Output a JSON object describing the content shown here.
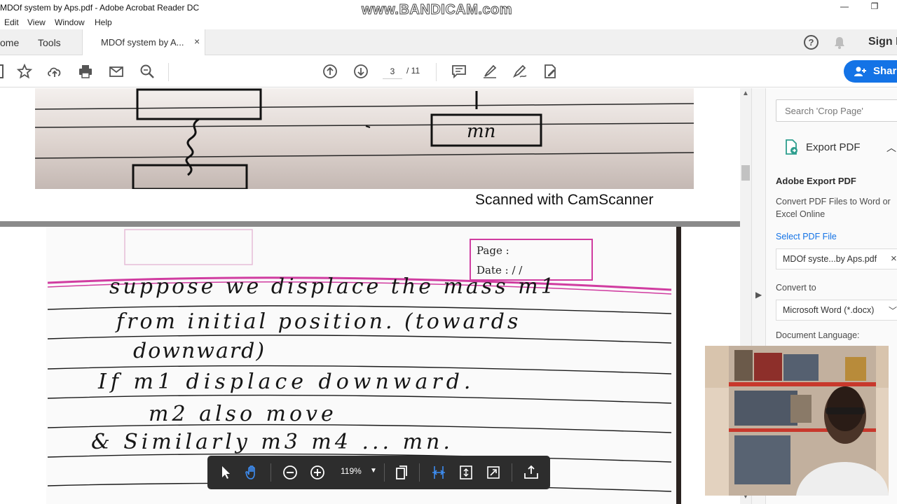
{
  "window": {
    "title": "MDOf system by Aps.pdf - Adobe Acrobat Reader DC",
    "watermark": "www.BANDICAM.com",
    "minimize": "—",
    "maximize": "❐"
  },
  "menubar": [
    "Edit",
    "View",
    "Window",
    "Help"
  ],
  "tabs": {
    "home": "ome",
    "tools": "Tools",
    "document": "MDOf system by A...",
    "close_glyph": "×"
  },
  "header_right": {
    "help_glyph": "?",
    "sign_in": "Sign In",
    "share": "Share"
  },
  "toolbar": {
    "page_current": "3",
    "page_total": "/ 11",
    "icons": [
      "bookmark-icon",
      "star-icon",
      "upload-icon",
      "print-icon",
      "email-icon",
      "zoom-search-icon",
      "page-up-icon",
      "page-down-icon",
      "comment-icon",
      "highlight-icon",
      "sign-icon",
      "edit-pdf-icon"
    ]
  },
  "document": {
    "camscanner_label": "Scanned with CamScanner",
    "top_scan_label": "mn",
    "page_box": {
      "page": "Page :",
      "date": "Date :   /   /"
    },
    "handwritten_lines": [
      "suppose we displace the mass m1",
      "from initial position. (towards",
      "downward)",
      "If m1 displace downward.",
      "m2 also move",
      "& Similarly m3 m4 ... mn."
    ]
  },
  "right_pane": {
    "search_placeholder": "Search 'Crop Page'",
    "export_header": "Export PDF",
    "export_title": "Adobe Export PDF",
    "export_desc": "Convert PDF Files to Word or Excel Online",
    "select_link": "Select PDF File",
    "file_name": "MDOf syste...by Aps.pdf",
    "file_close": "×",
    "convert_to_label": "Convert to",
    "convert_to_value": "Microsoft Word (*.docx)",
    "language_label": "Document Language:"
  },
  "floating_toolbar": {
    "zoom": "119%",
    "icons": [
      "select-arrow-icon",
      "hand-tool-icon",
      "zoom-out-icon",
      "zoom-in-icon",
      "page-view-icon",
      "fit-width-icon",
      "fit-page-icon",
      "full-screen-icon",
      "export-icon"
    ]
  },
  "colors": {
    "accent_blue": "#1473e6",
    "ruled_line_pink": "#d03ca0",
    "floating_bar": "#2d2d2d"
  }
}
